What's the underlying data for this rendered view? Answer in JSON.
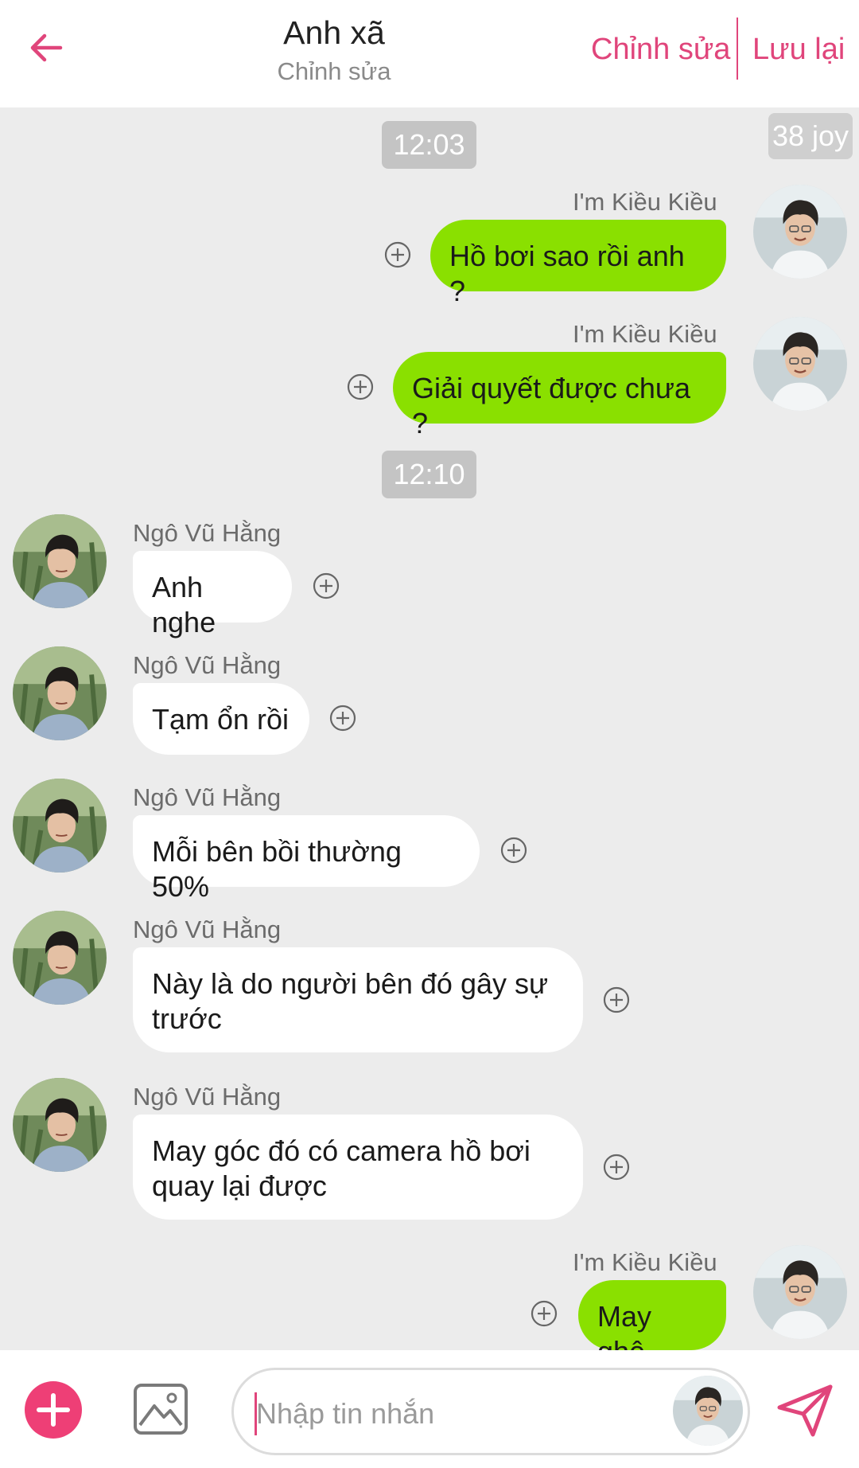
{
  "header": {
    "title": "Anh xã",
    "subtitle": "Chỉnh sửa",
    "edit_label": "Chỉnh sửa",
    "save_label": "Lưu lại"
  },
  "badge": "38 joy",
  "times": [
    "12:03",
    "12:10"
  ],
  "messages": [
    {
      "side": "out",
      "sender": "I'm Kiều Kiều",
      "text": "Hồ bơi sao rồi anh ?"
    },
    {
      "side": "out",
      "sender": "I'm Kiều Kiều",
      "text": "Giải quyết được chưa ?"
    },
    {
      "side": "in",
      "sender": "Ngô Vũ Hằng",
      "text": "Anh nghe"
    },
    {
      "side": "in",
      "sender": "Ngô Vũ Hằng",
      "text": "Tạm ổn rồi"
    },
    {
      "side": "in",
      "sender": "Ngô Vũ Hằng",
      "text": "Mỗi bên bồi thường 50%"
    },
    {
      "side": "in",
      "sender": "Ngô Vũ Hằng",
      "text": "Này là do người bên đó gây sự\ntrước"
    },
    {
      "side": "in",
      "sender": "Ngô Vũ Hằng",
      "text": "May góc đó có camera hồ bơi\nquay lại được"
    },
    {
      "side": "out",
      "sender": "I'm Kiều Kiều",
      "text": "May ghê"
    }
  ],
  "input": {
    "placeholder": "Nhập tin nhắn"
  },
  "colors": {
    "accent": "#e0457b",
    "outgoing_bubble": "#8ae000",
    "incoming_bubble": "#ffffff",
    "background": "#ececec"
  },
  "icons": [
    "back-arrow-icon",
    "plus-icon",
    "image-icon",
    "send-icon",
    "add-reaction-icon"
  ]
}
